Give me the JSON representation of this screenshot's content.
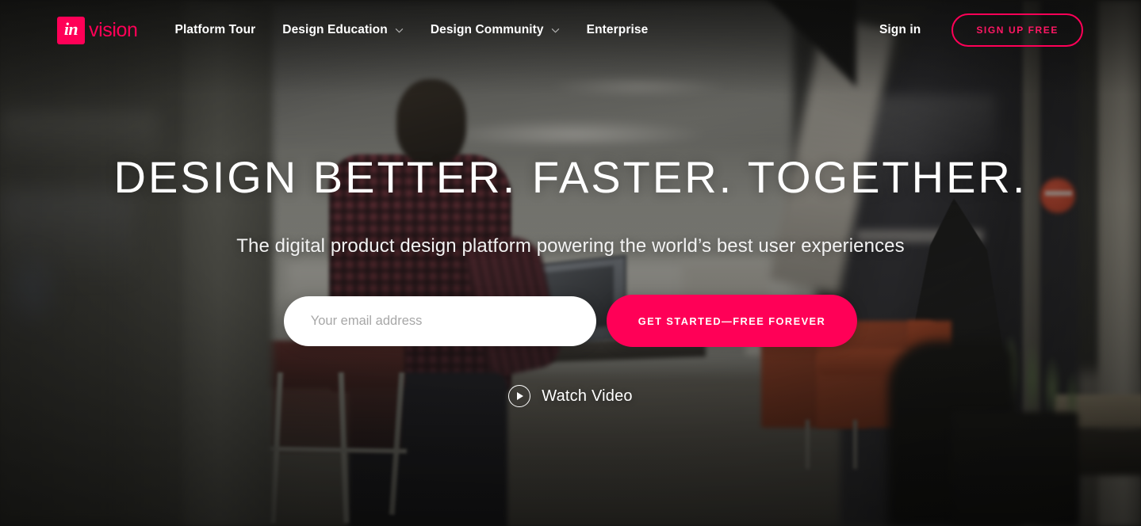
{
  "brand": {
    "logo_mark_text": "in",
    "logo_word_text": "vision",
    "accent_color": "#ff0057",
    "logo_mark_bg": "#ff0057"
  },
  "nav": {
    "links": [
      {
        "label": "Platform Tour",
        "has_dropdown": false
      },
      {
        "label": "Design Education",
        "has_dropdown": true,
        "icon": "chevron-down-icon"
      },
      {
        "label": "Design Community",
        "has_dropdown": true,
        "icon": "chevron-down-icon"
      },
      {
        "label": "Enterprise",
        "has_dropdown": false
      }
    ],
    "sign_in_label": "Sign in",
    "sign_up_label": "SIGN UP FREE"
  },
  "hero": {
    "headline": "DESIGN BETTER. FASTER. TOGETHER.",
    "subheadline": "The digital product design platform powering the world’s best user experiences",
    "email_placeholder": "Your email address",
    "email_value": "",
    "cta_label": "GET STARTED—FREE FOREVER",
    "watch_video_label": "Watch Video",
    "watch_video_icon": "play-circle-icon"
  }
}
